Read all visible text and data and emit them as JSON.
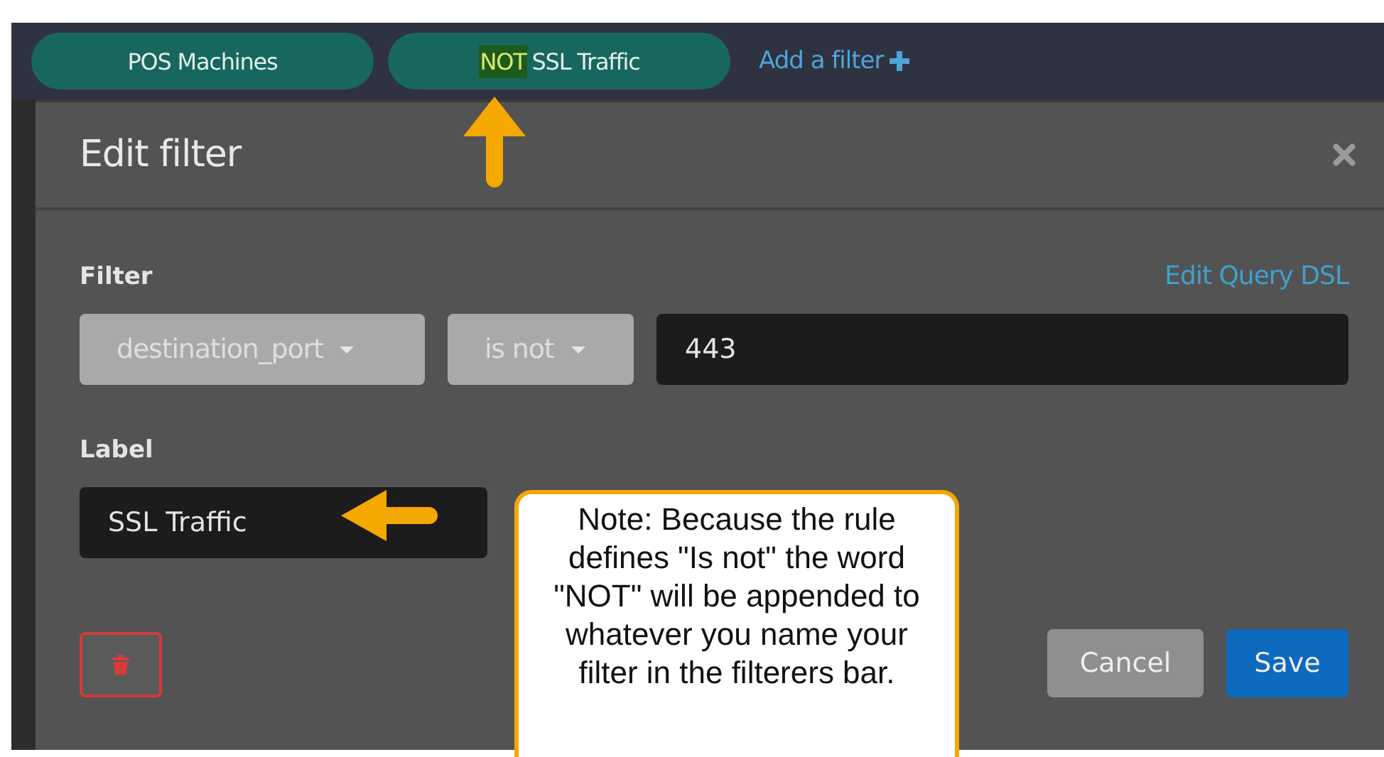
{
  "filter_bar": {
    "chips": [
      {
        "label": "POS Machines"
      },
      {
        "prefix": "NOT",
        "label": "SSL Traffic"
      }
    ],
    "add_link": "Add a filter"
  },
  "dialog": {
    "title": "Edit filter",
    "filter_label": "Filter",
    "dsl_link": "Edit Query DSL",
    "field_select": "destination_port",
    "operator_select": "is not",
    "value": "443",
    "label_heading": "Label",
    "label_value": "SSL Traffic",
    "buttons": [
      {
        "kind": "cancel",
        "label": "Cancel"
      },
      {
        "kind": "save",
        "label": "Save"
      }
    ]
  },
  "note": "Note: Because the rule defines \"Is not\" the word \"NOT\" will be appended to whatever you name your filter in the filterers bar."
}
